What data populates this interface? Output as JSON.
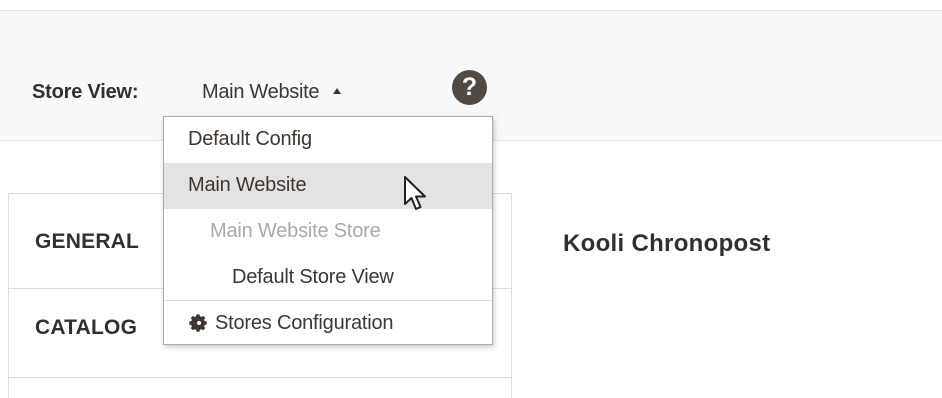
{
  "store_switcher": {
    "label": "Store View:",
    "current": "Main Website",
    "help_icon": "question-mark-icon",
    "help_symbol": "?"
  },
  "dropdown": {
    "items": [
      {
        "label": "Default Config",
        "level": 0,
        "state": "normal"
      },
      {
        "label": "Main Website",
        "level": 0,
        "state": "highlighted"
      },
      {
        "label": "Main Website Store",
        "level": 1,
        "state": "disabled"
      },
      {
        "label": "Default Store View",
        "level": 2,
        "state": "normal"
      }
    ],
    "footer": {
      "label": "Stores Configuration",
      "icon": "gear-icon"
    }
  },
  "tabs": [
    {
      "label": "GENERAL"
    },
    {
      "label": "CATALOG"
    }
  ],
  "content": {
    "title": "Kooli Chronopost"
  },
  "colors": {
    "header_bg": "#f8f8f8",
    "help_icon_bg": "#514943",
    "highlight_bg": "#e3e3e3",
    "disabled_text": "#a9a9a9",
    "text": "#303030"
  }
}
